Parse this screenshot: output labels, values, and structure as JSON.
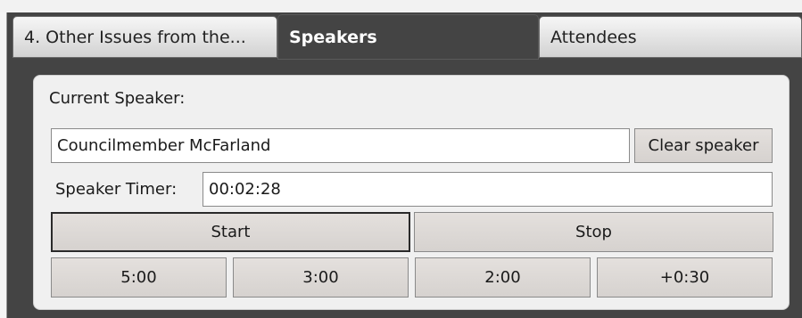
{
  "tabs": [
    {
      "label": "4. Other Issues from the..."
    },
    {
      "label": "Speakers"
    },
    {
      "label": "Attendees"
    }
  ],
  "panel": {
    "current_speaker_label": "Current Speaker:",
    "current_speaker_value": "Councilmember McFarland",
    "clear_button": "Clear speaker",
    "timer_label": "Speaker Timer:",
    "timer_value": "00:02:28",
    "start_button": "Start",
    "stop_button": "Stop",
    "preset_buttons": [
      "5:00",
      "3:00",
      "2:00",
      "+0:30"
    ]
  },
  "colors": {
    "background_dark": "#444444",
    "panel": "#f0f0f0",
    "button": "#d6d2cf"
  }
}
